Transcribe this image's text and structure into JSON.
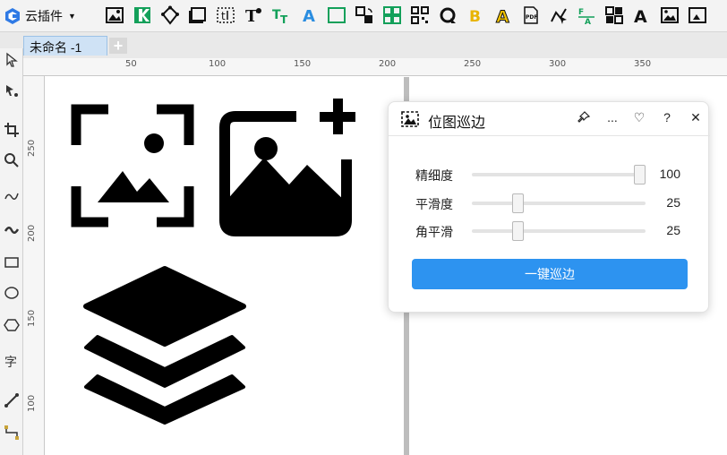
{
  "toolbar": {
    "plugin_menu_label": "云插件",
    "tools": [
      "image-trace-icon",
      "split-icon",
      "node-edit-icon",
      "frame-icon",
      "text-box-icon",
      "text-style-icon",
      "text-spacing-icon",
      "outline-text-icon",
      "rectangle-icon",
      "swap-icon",
      "grid-icon",
      "qr-icon",
      "refresh-icon",
      "bold-icon",
      "outlined-letter-icon",
      "pdf-icon",
      "node-cursor-icon",
      "text-edit-icon",
      "layout-icon",
      "letter-icon",
      "image-border-icon",
      "more-icon"
    ]
  },
  "tabs": {
    "document_name": "未命名 -1",
    "add_label": "+"
  },
  "ruler": {
    "horizontal": [
      "50",
      "100",
      "150",
      "200",
      "250",
      "300",
      "350"
    ],
    "vertical": [
      "250",
      "200",
      "150",
      "100"
    ]
  },
  "canvas": {
    "objects": [
      "image-frame-icon",
      "image-add-icon",
      "layers-icon"
    ]
  },
  "panel": {
    "title": "位图巡边",
    "header_buttons": {
      "pin": "pin-icon",
      "more": "...",
      "favorite": "♡",
      "help": "?",
      "close": "✕"
    },
    "sliders": [
      {
        "label": "精细度",
        "value": "100",
        "level": 1.0
      },
      {
        "label": "平滑度",
        "value": "25",
        "level": 0.25
      },
      {
        "label": "角平滑",
        "value": "25",
        "level": 0.25
      }
    ],
    "action_label": "一键巡边",
    "accent_color": "#2d93f0"
  }
}
